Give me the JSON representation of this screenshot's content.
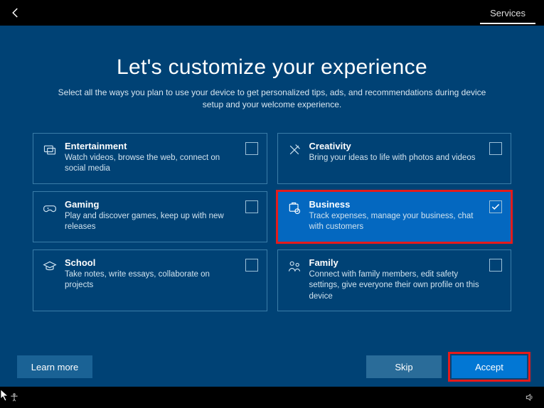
{
  "titlebar": {
    "tab": "Services"
  },
  "page": {
    "heading": "Let's customize your experience",
    "subheading": "Select all the ways you plan to use your device to get personalized tips, ads, and recommendations during device setup and your welcome experience."
  },
  "cards": [
    {
      "id": "entertainment",
      "icon": "entertainment-icon",
      "title": "Entertainment",
      "desc": "Watch videos, browse the web, connect on social media",
      "selected": false,
      "highlight": false
    },
    {
      "id": "creativity",
      "icon": "creativity-icon",
      "title": "Creativity",
      "desc": "Bring your ideas to life with photos and videos",
      "selected": false,
      "highlight": false
    },
    {
      "id": "gaming",
      "icon": "gaming-icon",
      "title": "Gaming",
      "desc": "Play and discover games, keep up with new releases",
      "selected": false,
      "highlight": false
    },
    {
      "id": "business",
      "icon": "business-icon",
      "title": "Business",
      "desc": "Track expenses, manage your business, chat with customers",
      "selected": true,
      "highlight": true
    },
    {
      "id": "school",
      "icon": "school-icon",
      "title": "School",
      "desc": "Take notes, write essays, collaborate on projects",
      "selected": false,
      "highlight": false
    },
    {
      "id": "family",
      "icon": "family-icon",
      "title": "Family",
      "desc": "Connect with family members, edit safety settings, give everyone their own profile on this device",
      "selected": false,
      "highlight": false
    }
  ],
  "buttons": {
    "learn_more": "Learn more",
    "skip": "Skip",
    "accept": "Accept",
    "accept_highlight": true
  },
  "colors": {
    "page_bg": "#004275",
    "accent": "#0468c0",
    "highlight_outline": "#e41b1b"
  }
}
